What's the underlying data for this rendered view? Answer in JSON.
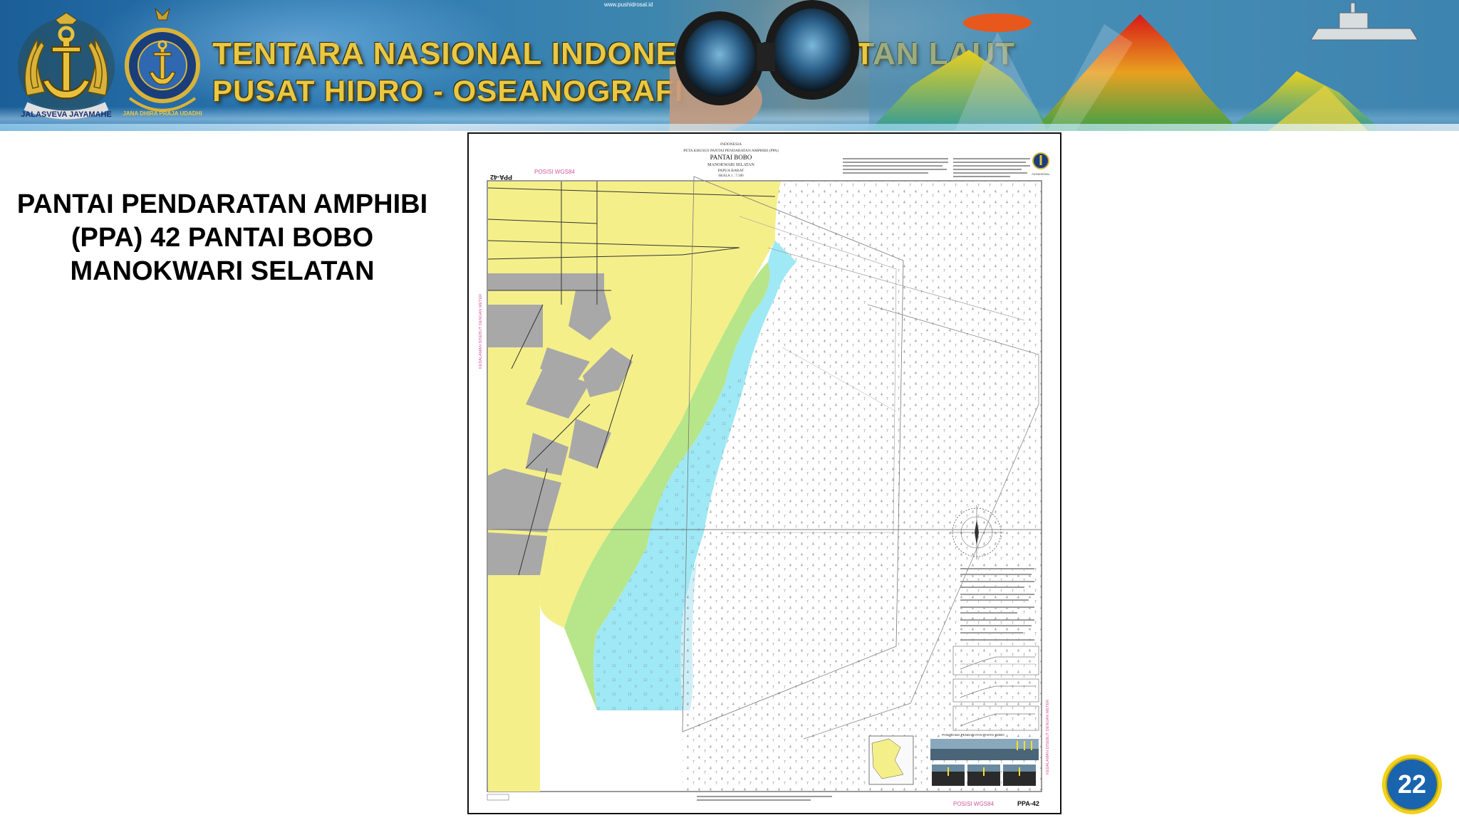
{
  "banner": {
    "title": "TENTARA NASIONAL INDONESIA ANGKATAN LAUT",
    "subtitle": "PUSAT HIDRO - OSEANOGRAFI",
    "url": "www.pushidrosal.id",
    "emblem_left_motto": "JALASVEVA JAYAMAHE",
    "emblem_right_motto": "JANA DHIRA PRAJA UDADHI"
  },
  "slide": {
    "title_lines": [
      "PANTAI PENDARATAN AMPHIBI",
      "(PPA) 42 PANTAI BOBO",
      "MANOKWARI SELATAN"
    ],
    "page_number": "22"
  },
  "map": {
    "code_top": "PPA-42",
    "code_bottom": "PPA-42",
    "posisi_top": "POSISI WGS84",
    "posisi_bottom": "POSISI WGS84",
    "header_lines": [
      "INDONESIA",
      "PETA KHUSUS PANTAI PENDARATAN AMPHIBI (PPA)",
      "PANTAI BOBO",
      "MANOKWARI SELATAN",
      "PAPUA BARAT",
      "SKALA 1 : 7.500"
    ],
    "side_label_left": "KEDALAMAN DISEBUT DENGAN METER",
    "side_label_right": "KEDALAMAN DISEBUT DENGAN METER",
    "panorama_label": "PANORAMA PENDARATAN PANTAI BOBO"
  },
  "colors": {
    "land": "#f5ef8a",
    "built_up": "#a8a8a8",
    "green_shallow": "#b7e58a",
    "blue_shallow": "#9fe8f5",
    "deep": "#ffffff",
    "title_gold": "#e8c844",
    "badge": "#1a64ae"
  }
}
